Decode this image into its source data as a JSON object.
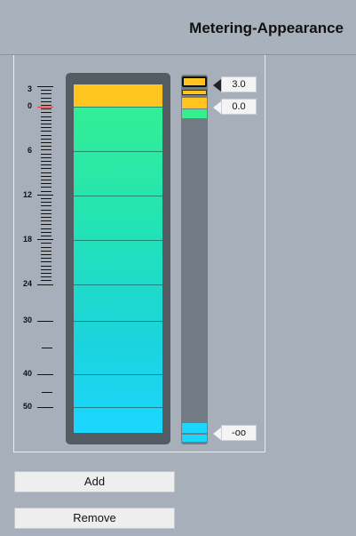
{
  "header": {
    "title": "Metering-Appearance"
  },
  "scale": {
    "labels": {
      "l3": "3",
      "l0": "0",
      "l6": "6",
      "l12": "12",
      "l18": "18",
      "l24": "24",
      "l30": "30",
      "l40": "40",
      "l50": "50"
    }
  },
  "handles": {
    "top": "3.0",
    "middle": "0.0",
    "bottom": "-oo"
  },
  "colors": {
    "clip": "#ffc41f",
    "green": "#36f08f",
    "cyan": "#1bd7ff",
    "frame": "#545b63",
    "zero_marker": "#e23a3a"
  },
  "buttons": {
    "add": "Add",
    "remove": "Remove"
  }
}
